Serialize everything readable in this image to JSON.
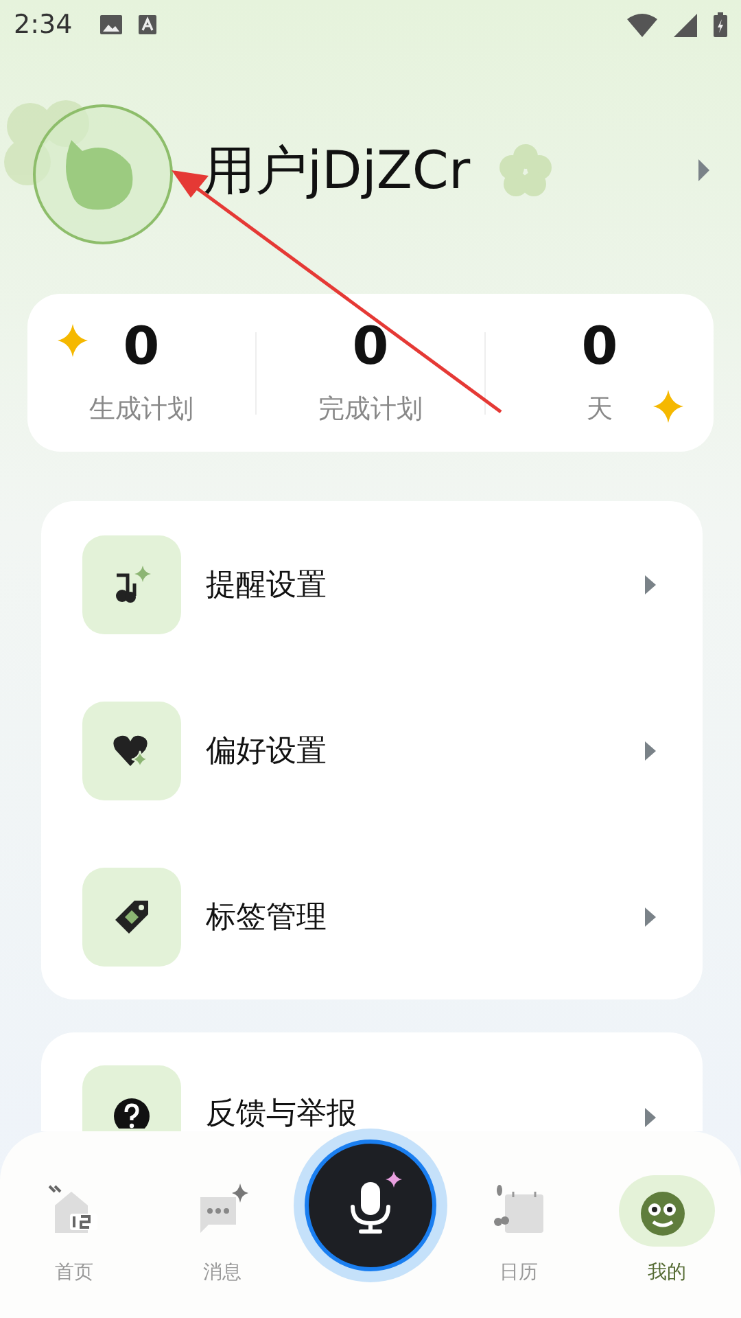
{
  "status_bar": {
    "time": "2:34"
  },
  "profile": {
    "username": "用户jDjZCr"
  },
  "stats": [
    {
      "value": "0",
      "label": "生成计划"
    },
    {
      "value": "0",
      "label": "完成计划"
    },
    {
      "value": "0",
      "label": "天"
    }
  ],
  "menu_groups": [
    [
      {
        "label": "提醒设置",
        "kind": "music"
      },
      {
        "label": "偏好设置",
        "kind": "heart"
      },
      {
        "label": "标签管理",
        "kind": "tag"
      }
    ],
    [
      {
        "label": "反馈与举报",
        "kind": "help"
      }
    ]
  ],
  "nav": {
    "items": [
      {
        "label": "首页",
        "kind": "home",
        "selected": false
      },
      {
        "label": "消息",
        "kind": "chat",
        "selected": false
      },
      {
        "label": "日历",
        "kind": "calendar",
        "selected": false
      },
      {
        "label": "我的",
        "kind": "face",
        "selected": true
      }
    ]
  }
}
